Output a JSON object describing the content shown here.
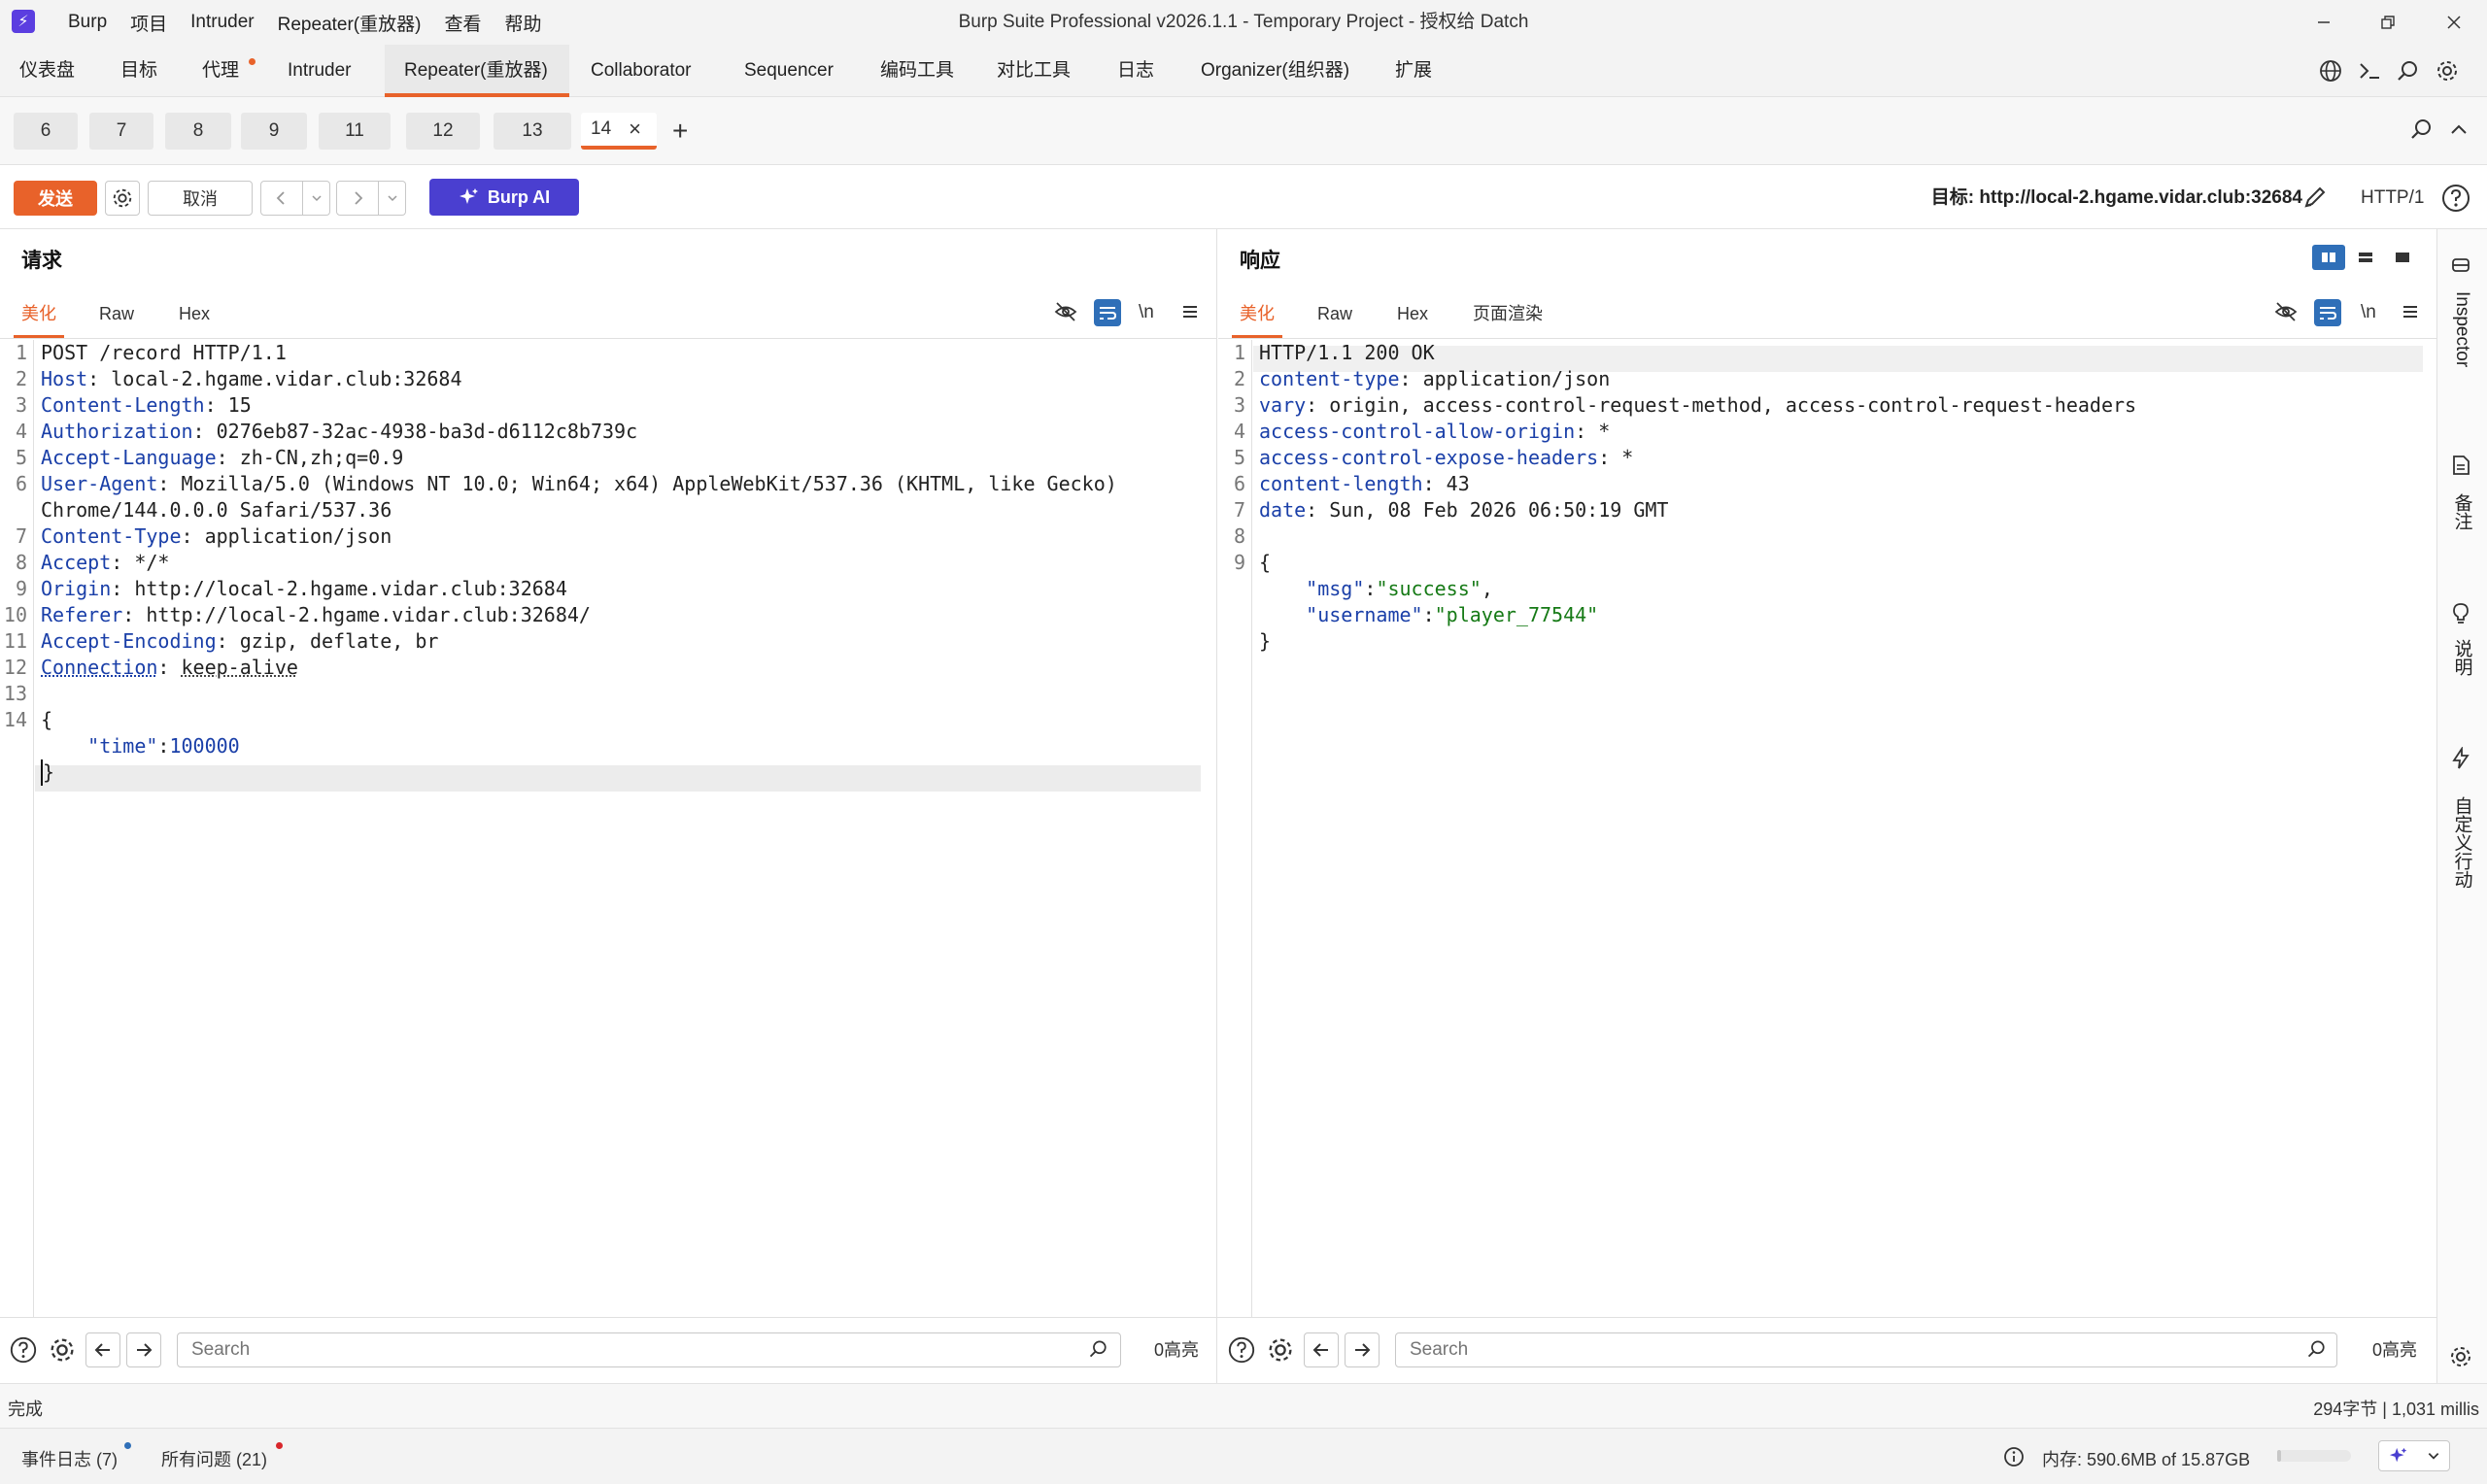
{
  "window": {
    "title": "Burp Suite Professional v2026.1.1 - Temporary Project - 授权给 Datch",
    "logo_glyph": "⚡",
    "menu": [
      "Burp",
      "项目",
      "Intruder",
      "Repeater(重放器)",
      "查看",
      "帮助"
    ]
  },
  "nav": {
    "tabs": [
      "仪表盘",
      "目标",
      "代理",
      "Intruder",
      "Repeater(重放器)",
      "Collaborator",
      "Sequencer",
      "编码工具",
      "对比工具",
      "日志",
      "Organizer(组织器)",
      "扩展"
    ],
    "active": "Repeater(重放器)"
  },
  "repeater_tabs": {
    "tabs": [
      "6",
      "7",
      "8",
      "9",
      "11",
      "12",
      "13",
      "14"
    ],
    "active": "14",
    "close_glyph": "×",
    "add_glyph": "+"
  },
  "toolbar": {
    "send_label": "发送",
    "cancel_label": "取消",
    "burp_ai_label": "Burp AI",
    "target_label": "目标: http://local-2.hgame.vidar.club:32684",
    "http_version": "HTTP/1"
  },
  "request": {
    "title": "请求",
    "tabs": [
      "美化",
      "Raw",
      "Hex"
    ],
    "newline_toggle": "\\n",
    "lines": [
      {
        "n": "1",
        "name": "",
        "sep": "",
        "value": "POST /record HTTP/1.1"
      },
      {
        "n": "2",
        "name": "Host",
        "sep": ": ",
        "value": "local-2.hgame.vidar.club:32684"
      },
      {
        "n": "3",
        "name": "Content-Length",
        "sep": ": ",
        "value": "15"
      },
      {
        "n": "4",
        "name": "Authorization",
        "sep": ": ",
        "value": "0276eb87-32ac-4938-ba3d-d6112c8b739c"
      },
      {
        "n": "5",
        "name": "Accept-Language",
        "sep": ": ",
        "value": "zh-CN,zh;q=0.9"
      },
      {
        "n": "6",
        "name": "User-Agent",
        "sep": ": ",
        "value": "Mozilla/5.0 (Windows NT 10.0; Win64; x64) AppleWebKit/537.36 (KHTML, like Gecko)"
      },
      {
        "n": "",
        "name": "",
        "sep": "",
        "value": "Chrome/144.0.0.0 Safari/537.36"
      },
      {
        "n": "7",
        "name": "Content-Type",
        "sep": ": ",
        "value": "application/json"
      },
      {
        "n": "8",
        "name": "Accept",
        "sep": ": ",
        "value": "*/*"
      },
      {
        "n": "9",
        "name": "Origin",
        "sep": ": ",
        "value": "http://local-2.hgame.vidar.club:32684"
      },
      {
        "n": "10",
        "name": "Referer",
        "sep": ": ",
        "value": "http://local-2.hgame.vidar.club:32684/"
      },
      {
        "n": "11",
        "name": "Accept-Encoding",
        "sep": ": ",
        "value": "gzip, deflate, br"
      },
      {
        "n": "12",
        "name": "Connection",
        "sep": ": ",
        "value": "keep-alive"
      },
      {
        "n": "13",
        "name": "",
        "sep": "",
        "value": ""
      },
      {
        "n": "14",
        "name": "",
        "sep": "",
        "value": "{"
      },
      {
        "n": "",
        "name": "",
        "sep": "",
        "value": "    ",
        "json_key": "\"time\"",
        "json_sep": ":",
        "json_val": "100000"
      },
      {
        "n": "",
        "name": "",
        "sep": "",
        "value": "}"
      }
    ],
    "search_placeholder": "Search",
    "highlights": "0高亮"
  },
  "response": {
    "title": "响应",
    "tabs": [
      "美化",
      "Raw",
      "Hex",
      "页面渲染"
    ],
    "newline_toggle": "\\n",
    "lines": [
      {
        "n": "1",
        "name": "",
        "sep": "",
        "value": "HTTP/1.1 200 OK"
      },
      {
        "n": "2",
        "name": "content-type",
        "sep": ": ",
        "value": "application/json"
      },
      {
        "n": "3",
        "name": "vary",
        "sep": ": ",
        "value": "origin, access-control-request-method, access-control-request-headers"
      },
      {
        "n": "4",
        "name": "access-control-allow-origin",
        "sep": ": ",
        "value": "*"
      },
      {
        "n": "5",
        "name": "access-control-expose-headers",
        "sep": ": ",
        "value": "*"
      },
      {
        "n": "6",
        "name": "content-length",
        "sep": ": ",
        "value": "43"
      },
      {
        "n": "7",
        "name": "date",
        "sep": ": ",
        "value": "Sun, 08 Feb 2026 06:50:19 GMT"
      },
      {
        "n": "8",
        "name": "",
        "sep": "",
        "value": ""
      },
      {
        "n": "9",
        "name": "",
        "sep": "",
        "value": "{"
      },
      {
        "n": "",
        "name": "",
        "sep": "",
        "value": "    ",
        "json_key": "\"msg\"",
        "json_sep": ":",
        "json_val": "\"success\"",
        "json_trail": ","
      },
      {
        "n": "",
        "name": "",
        "sep": "",
        "value": "    ",
        "json_key": "\"username\"",
        "json_sep": ":",
        "json_val": "\"player_77544\""
      },
      {
        "n": "",
        "name": "",
        "sep": "",
        "value": "}"
      }
    ],
    "search_placeholder": "Search",
    "highlights": "0高亮"
  },
  "sidebar": {
    "items": [
      "Inspector",
      "备注",
      "说明",
      "自定义行动"
    ]
  },
  "status": {
    "left": "完成",
    "right": "294字节 | 1,031 millis"
  },
  "bottom": {
    "event_log": "事件日志 (7)",
    "all_issues": "所有问题 (21)",
    "memory": "内存: 590.6MB of 15.87GB"
  },
  "colors": {
    "accent": "#e8622a",
    "burp_ai": "#4a3fd0",
    "header_name": "#1a3fa8",
    "json_string": "#167a16"
  }
}
